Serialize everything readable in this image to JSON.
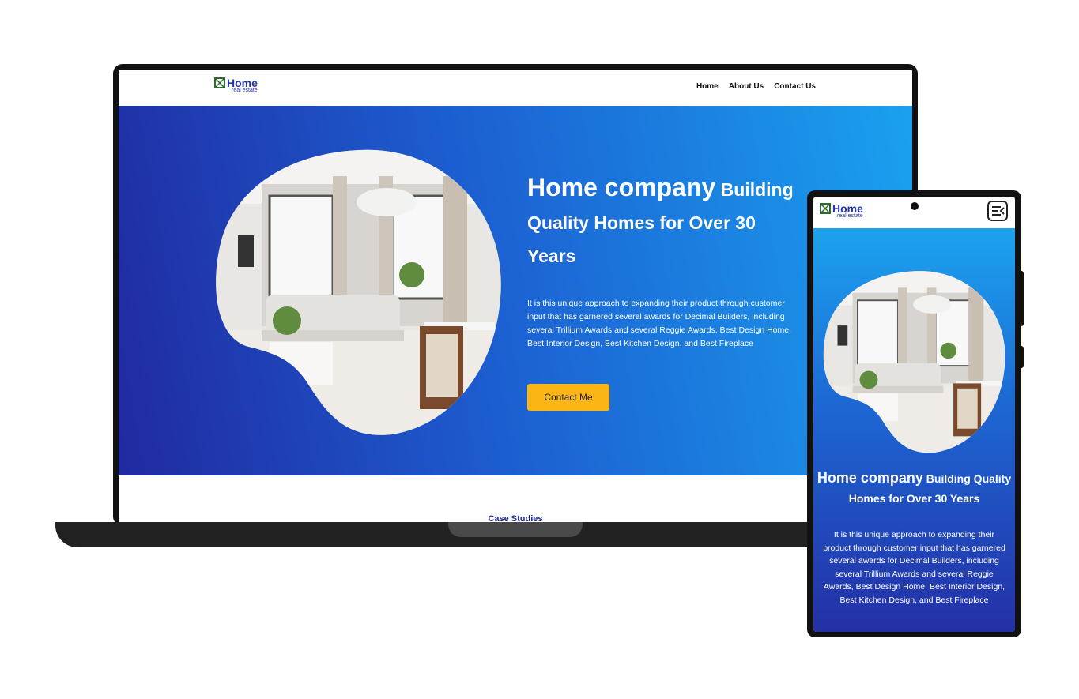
{
  "brand": {
    "name": "Home",
    "tagline": "real estate"
  },
  "nav": {
    "items": [
      "Home",
      "About Us",
      "Contact Us"
    ]
  },
  "hero": {
    "title_main": "Home company",
    "title_rest": "Building Quality Homes for Over 30 Years",
    "description": "It is this unique approach to expanding their product through customer input that has garnered several awards for Decimal Builders, including several Trillium Awards and several Reggie Awards, Best Design Home, Best Interior Design, Best Kitchen Design, and Best Fireplace",
    "cta_label": "Contact Me",
    "image_icon": "living-room-photo"
  },
  "next_section": {
    "title": "Case Studies"
  },
  "mobile_menu_icon": "menu-collapse-icon",
  "colors": {
    "brand_blue": "#2233a8",
    "hero_gradient_start": "#2129a0",
    "hero_gradient_end": "#1aa1ef",
    "cta": "#fbb515",
    "device_frame": "#111111"
  }
}
